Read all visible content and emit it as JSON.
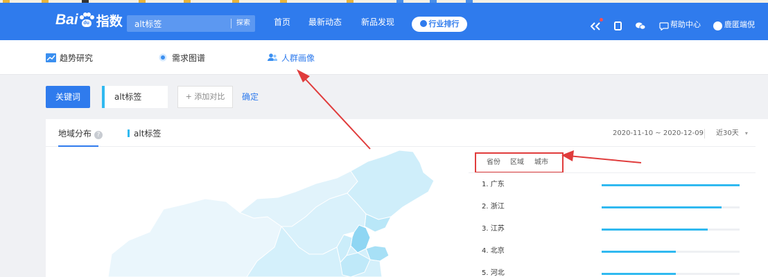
{
  "colors": {
    "brand": "#2f7bed",
    "accent": "#30b9f0",
    "annotation": "#e03c3c"
  },
  "logo": {
    "bai": "Bai",
    "du": "du",
    "zhishu": "指数"
  },
  "search": {
    "value": "alt标签",
    "button": "探索"
  },
  "nav": {
    "items": [
      "首页",
      "最新动态",
      "新品发现"
    ],
    "hot": "行业排行"
  },
  "user_nav": {
    "help": "帮助中心",
    "user": "鹿匿端倪"
  },
  "subnav": {
    "items": [
      {
        "label": "趋势研究",
        "icon": "trend-chart-icon",
        "active": false
      },
      {
        "label": "需求图谱",
        "icon": "graph-node-icon",
        "active": false
      },
      {
        "label": "人群画像",
        "icon": "people-icon",
        "active": true
      }
    ]
  },
  "keywords": {
    "button": "关键词",
    "tag": "alt标签",
    "add": "+ 添加对比",
    "confirm": "确定"
  },
  "panel": {
    "tab": "地域分布",
    "series": "alt标签",
    "date_range": "2020-11-10 ~ 2020-12-09",
    "period": "近30天",
    "period_arrow": "▾"
  },
  "region_tabs": [
    "省份",
    "区域",
    "城市"
  ],
  "ranking": [
    {
      "label": "1.  广东",
      "value": 1.0
    },
    {
      "label": "2.  浙江",
      "value": 0.87
    },
    {
      "label": "3.  江苏",
      "value": 0.77
    },
    {
      "label": "4.  北京",
      "value": 0.54
    },
    {
      "label": "5.  河北",
      "value": 0.54
    }
  ]
}
